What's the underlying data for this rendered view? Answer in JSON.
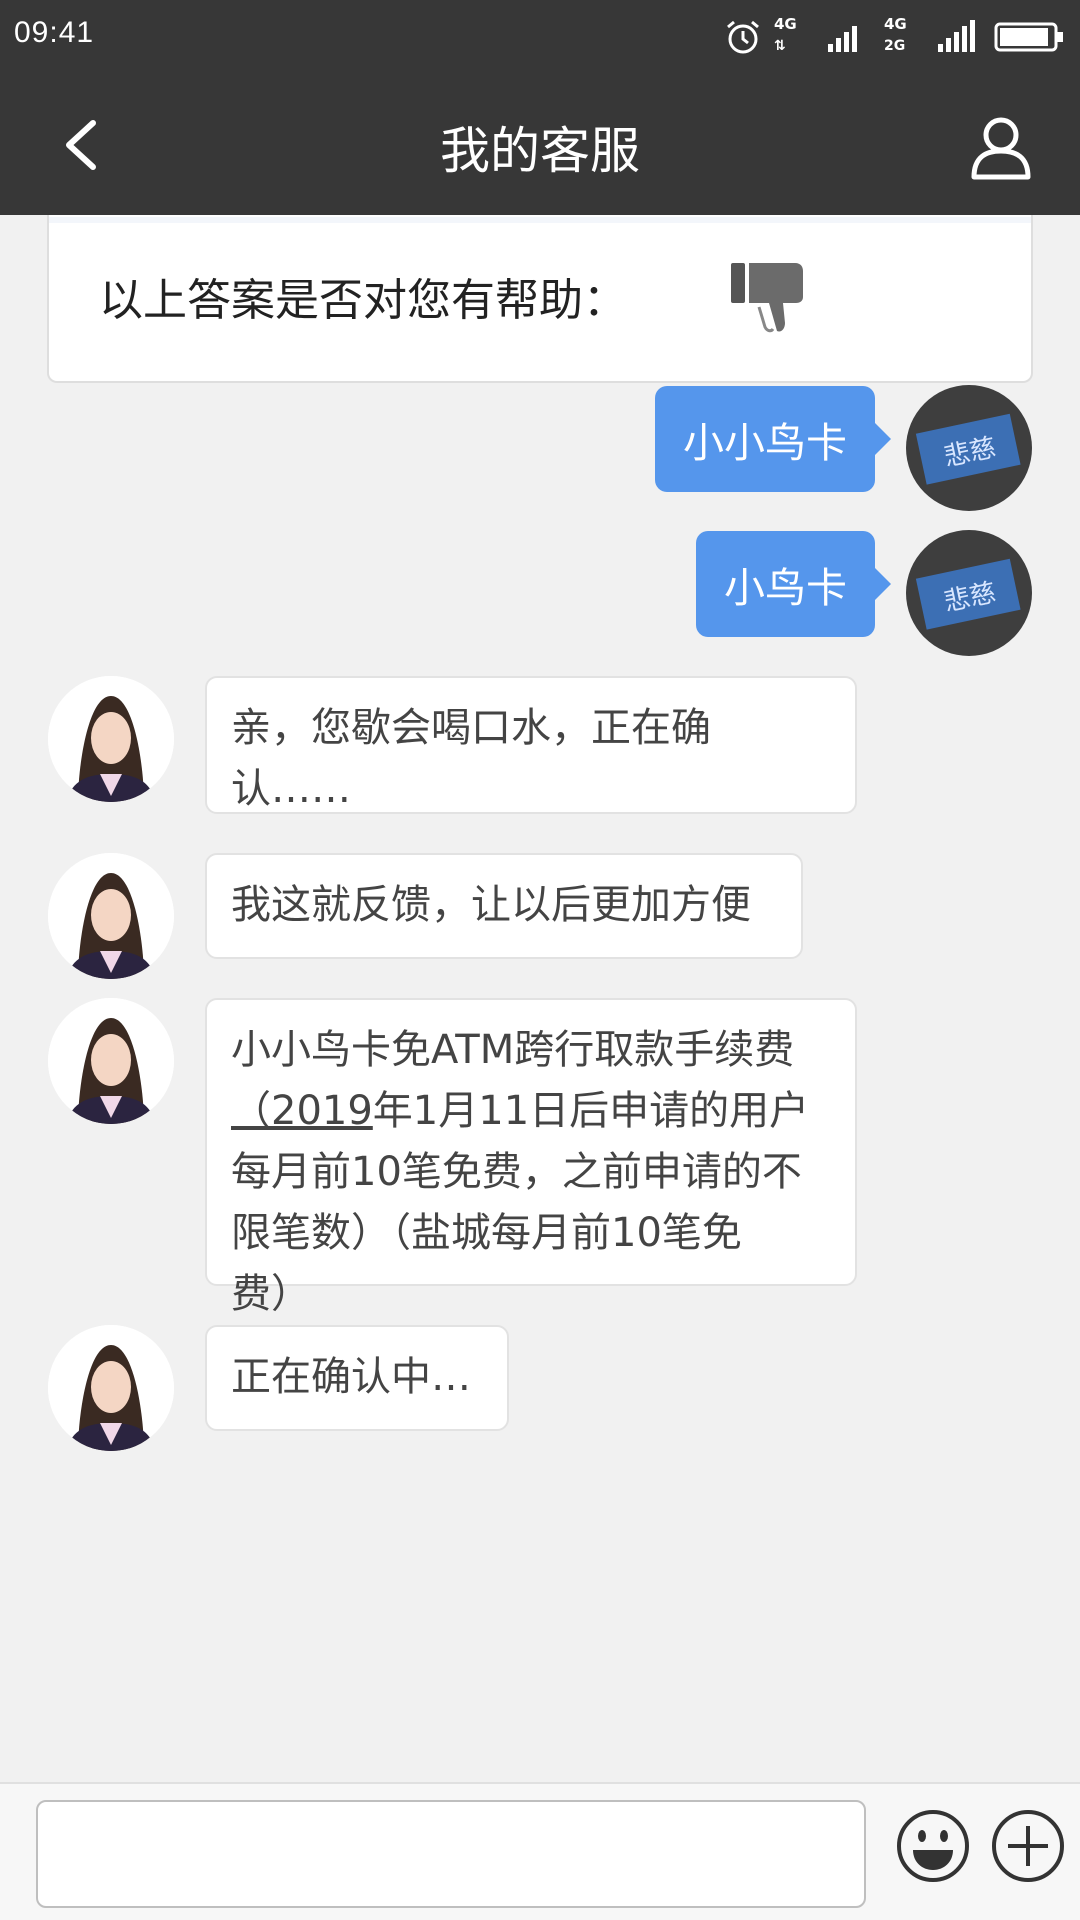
{
  "status_bar": {
    "time": "09:41",
    "network_top": "4G",
    "network_top2": "4G",
    "network_bottom": "2G"
  },
  "header": {
    "title": "我的客服"
  },
  "feedback": {
    "question": "以上答案是否对您有帮助："
  },
  "messages": [
    {
      "from": "user",
      "text": "小小鸟卡"
    },
    {
      "from": "user",
      "text": "小鸟卡"
    },
    {
      "from": "agent",
      "lines": [
        "亲，您歇会喝口水，正在确",
        "认……"
      ]
    },
    {
      "from": "agent",
      "lines": [
        "我这就反馈，让以后更加方便"
      ]
    },
    {
      "from": "agent",
      "lines_rich": [
        {
          "plain": "小小鸟卡免ATM跨行取款手续费"
        },
        {
          "under": "（2019",
          "plain": "年1月11日后申请的用户"
        },
        {
          "plain": "每月前10笔免费，之前申请的不"
        },
        {
          "plain": "限笔数）（盐城每月前10笔免"
        },
        {
          "plain": "费）"
        }
      ]
    },
    {
      "from": "agent",
      "lines": [
        "正在确认中…"
      ]
    }
  ],
  "input": {
    "placeholder": ""
  },
  "colors": {
    "bar": "#373737",
    "user_bubble": "#5596ec",
    "background": "#f1f1f1"
  }
}
